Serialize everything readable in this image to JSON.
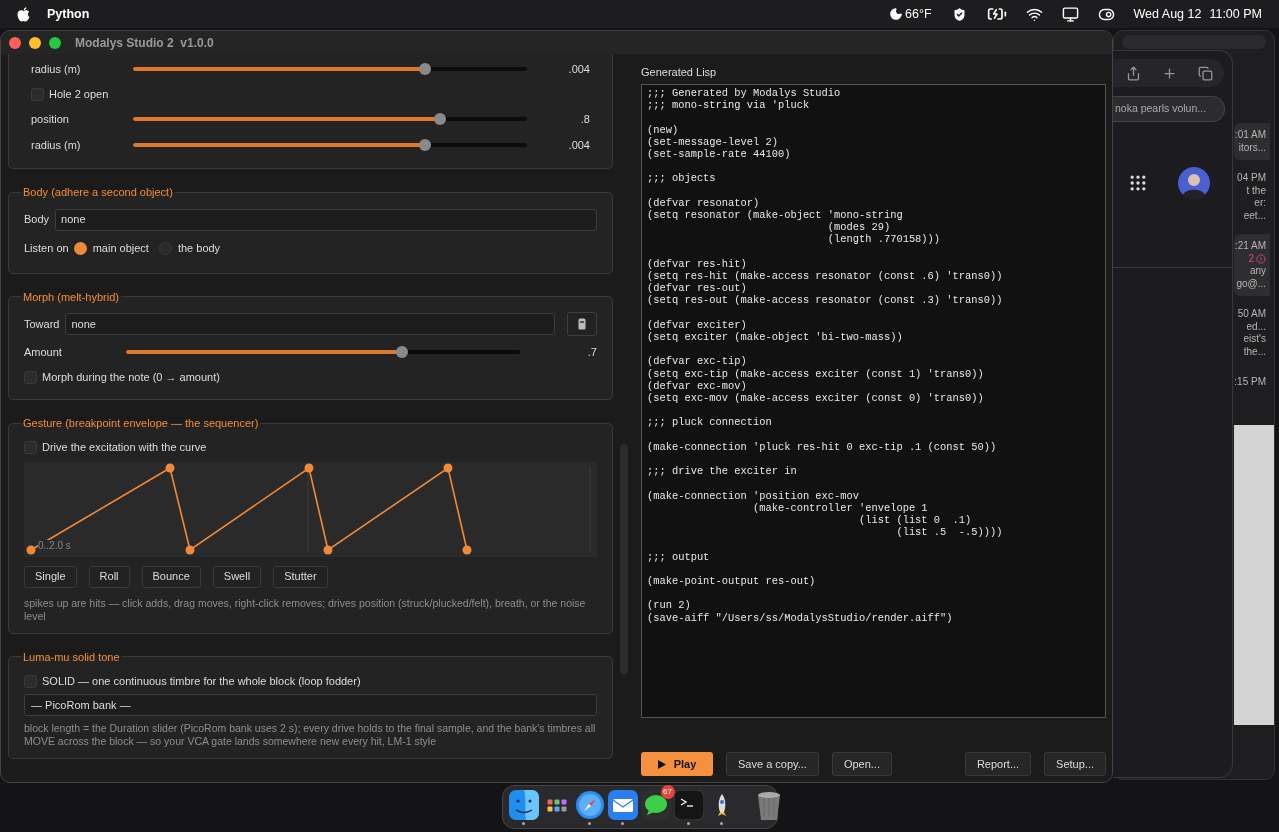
{
  "menu_bar": {
    "app": "Python",
    "weather": "66°F",
    "date": "Wed Aug 12",
    "time": "11:00 PM"
  },
  "window": {
    "title": "Modalys Studio 2  v1.0.0"
  },
  "sections": [
    {
      "rows": [
        {
          "kind": "slider",
          "label": "radius (m)",
          "level": 0.74,
          "reading": ".004"
        },
        {
          "kind": "checkbox",
          "label": "Hole 2 open",
          "checked": false
        },
        {
          "kind": "slider",
          "label": "position",
          "level": 0.78,
          "reading": ".8"
        },
        {
          "kind": "slider",
          "label": "radius (m)",
          "level": 0.74,
          "reading": ".004"
        }
      ]
    },
    {
      "title": "Body (adhere a second object)",
      "rows": [
        {
          "kind": "field",
          "label": "Body",
          "value": "none"
        },
        {
          "kind": "radio",
          "label": "Listen on",
          "options": [
            {
              "label": "main object",
              "selected": true
            },
            {
              "label": "the body",
              "selected": false
            }
          ]
        }
      ]
    },
    {
      "title": "Morph (melt-hybrid)",
      "rows": [
        {
          "kind": "field_picker",
          "label": "Toward",
          "value": "none"
        },
        {
          "kind": "slider",
          "label": "Amount",
          "level": 0.7,
          "reading": ".7"
        },
        {
          "kind": "checkbox",
          "label": "Morph during the note (0 → amount)",
          "checked": false
        }
      ]
    },
    {
      "title": "Gesture (breakpoint envelope — the sequencer)",
      "rows": [
        {
          "kind": "checkbox",
          "label": "Drive the excitation with the curve",
          "checked": false
        },
        {
          "kind": "envelope",
          "caption": "0..2.0 s"
        },
        {
          "kind": "buttons",
          "items": [
            "Single",
            "Roll",
            "Bounce",
            "Swell",
            "Stutter"
          ]
        },
        {
          "kind": "note",
          "text": "spikes up are hits — click adds, drag moves, right-click removes; drives position (struck/plucked/felt), breath, or the noise level"
        }
      ]
    },
    {
      "title": "Luma-mu solid tone",
      "rows": [
        {
          "kind": "checkbox",
          "label": "SOLID — one continuous timbre for the whole block (loop fodder)",
          "checked": false
        },
        {
          "kind": "select",
          "value": "— PicoRom bank —"
        },
        {
          "kind": "note",
          "text": "block length = the Duration slider (PicoRom bank uses 2 s); every drive holds to the final sample, and the bank's timbres all MOVE across the block — so your VCA gate lands somewhere new every hit, LM-1 style"
        }
      ]
    }
  ],
  "lisp": {
    "title": "Generated Lisp",
    "blocks": [
      [
        ";;; Generated by Modalys Studio",
        ";;; mono-string via 'pluck"
      ],
      [
        "(new)",
        "(set-message-level 2)",
        "(set-sample-rate 44100)"
      ],
      [
        ";;; objects"
      ],
      [
        "(defvar resonator)",
        "(setq resonator (make-object 'mono-string",
        "                             (modes 29)",
        "                             (length .770158)))"
      ],
      [
        "(defvar res-hit)",
        "(setq res-hit (make-access resonator (const .6) 'trans0))",
        "(defvar res-out)",
        "(setq res-out (make-access resonator (const .3) 'trans0))"
      ],
      [
        "(defvar exciter)",
        "(setq exciter (make-object 'bi-two-mass))"
      ],
      [
        "(defvar exc-tip)",
        "(setq exc-tip (make-access exciter (const 1) 'trans0))",
        "(defvar exc-mov)",
        "(setq exc-mov (make-access exciter (const 0) 'trans0))"
      ],
      [
        ";;; pluck connection"
      ],
      [
        "(make-connection 'pluck res-hit 0 exc-tip .1 (const 50))"
      ],
      [
        ";;; drive the exciter in"
      ],
      [
        "(make-connection 'position exc-mov",
        "                 (make-controller 'envelope 1",
        "                                  (list (list 0  .1)",
        "                                        (list .5  -.5))))"
      ],
      [
        ";;; output"
      ],
      [
        "(make-point-output res-out)"
      ],
      [
        "(run 2)",
        "(save-aiff \"/Users/ss/ModalysStudio/render.aiff\")"
      ]
    ]
  },
  "actions": [
    {
      "label": "Play",
      "kind": "primary"
    },
    {
      "label": "Save a copy...",
      "kind": "normal"
    },
    {
      "label": "Open...",
      "kind": "normal"
    },
    {
      "kind": "spacer"
    },
    {
      "label": "Report...",
      "kind": "normal"
    },
    {
      "label": "Setup...",
      "kind": "normal"
    }
  ],
  "browser": {
    "search": "noka pearls volun..."
  },
  "mail_strip": [
    {
      "lines": [
        ":01 AM",
        "itors..."
      ],
      "highlighted": true
    },
    {
      "lines": [
        "04 PM",
        "t the",
        "er:",
        "eet..."
      ],
      "highlighted": false
    },
    {
      "lines": [
        ":21 AM",
        "2",
        "any",
        "go@..."
      ],
      "highlighted": true
    },
    {
      "lines": [
        "50 AM",
        "ed...",
        "eist's",
        "the..."
      ],
      "highlighted": false
    },
    {
      "lines": [
        ":15 PM"
      ],
      "highlighted": false
    }
  ],
  "dock": [
    {
      "kind": "finder",
      "running": true
    },
    {
      "kind": "launchpad",
      "running": false
    },
    {
      "kind": "safari",
      "running": true
    },
    {
      "kind": "mail",
      "running": true
    },
    {
      "kind": "messages",
      "running": false,
      "badge": "67"
    },
    {
      "kind": "terminal",
      "running": true
    },
    {
      "kind": "rocket",
      "running": true
    },
    {
      "kind": "trash",
      "running": false
    }
  ]
}
